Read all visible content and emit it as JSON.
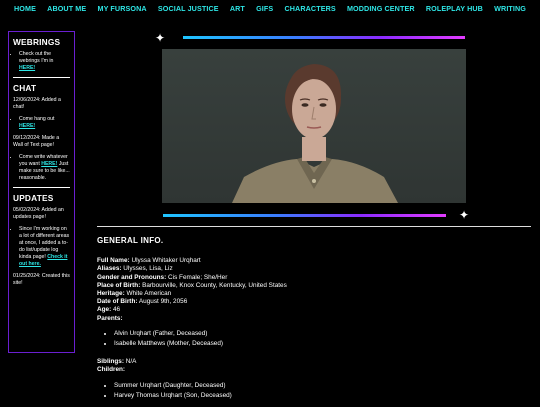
{
  "nav": [
    "HOME",
    "ABOUT ME",
    "MY FURSONA",
    "SOCIAL JUSTICE",
    "ART",
    "GIFS",
    "CHARACTERS",
    "MODDING CENTER",
    "ROLEPLAY HUB",
    "WRITING"
  ],
  "sidebar": {
    "webrings_title": "WEBRINGS",
    "webrings_text": "Check out the webrings I'm in",
    "webrings_link": "HERE!",
    "chat_title": "CHAT",
    "chat_date1": "12/06/2024: Added a chat!",
    "chat_item1_text": "Come hang out",
    "chat_item1_link": "HERE!",
    "chat_date2": "09/12/2024: Made a Wall of Text page!",
    "chat_item2_text": "Come write whatever you want",
    "chat_item2_link": "HERE!",
    "chat_item2_tail": "Just make sure to be like... reasonable.",
    "updates_title": "UPDATES",
    "upd_date1": "05/02/2024: Added an updates page!",
    "upd_item_text": "Since I'm working on a lot of different areas at once, I added a to-do list/update log kinda page!",
    "upd_item_link": "Check it out here.",
    "upd_date2": "01/25/2024: Created this site!"
  },
  "portrait": {
    "hair_color": "#5a3a2e",
    "skin_color": "#caa896",
    "uniform_color": "#8a7f66"
  },
  "info": {
    "heading": "GENERAL INFO.",
    "full_name_label": "Full Name:",
    "full_name": "Ulyssa Whitaker Urqhart",
    "aliases_label": "Aliases:",
    "aliases": "Ulysses, Lisa, Liz",
    "gender_label": "Gender and Pronouns:",
    "gender": "Cis Female; She/Her",
    "pob_label": "Place of Birth:",
    "pob": "Barbourville, Knox County, Kentucky, United States",
    "heritage_label": "Heritage:",
    "heritage": "White American",
    "dob_label": "Date of Birth:",
    "dob": "August 9th, 2056",
    "age_label": "Age:",
    "age": "46",
    "parents_label": "Parents:",
    "parents": [
      "Alvin Urqhart (Father, Deceased)",
      "Isabelle Matthews (Mother, Deceased)"
    ],
    "siblings_label": "Siblings:",
    "siblings": "N/A",
    "children_label": "Children:",
    "children": [
      "Summer Urqhart (Daughter, Deceased)",
      "Harvey Thomas Urqhart (Son, Deceased)"
    ]
  }
}
